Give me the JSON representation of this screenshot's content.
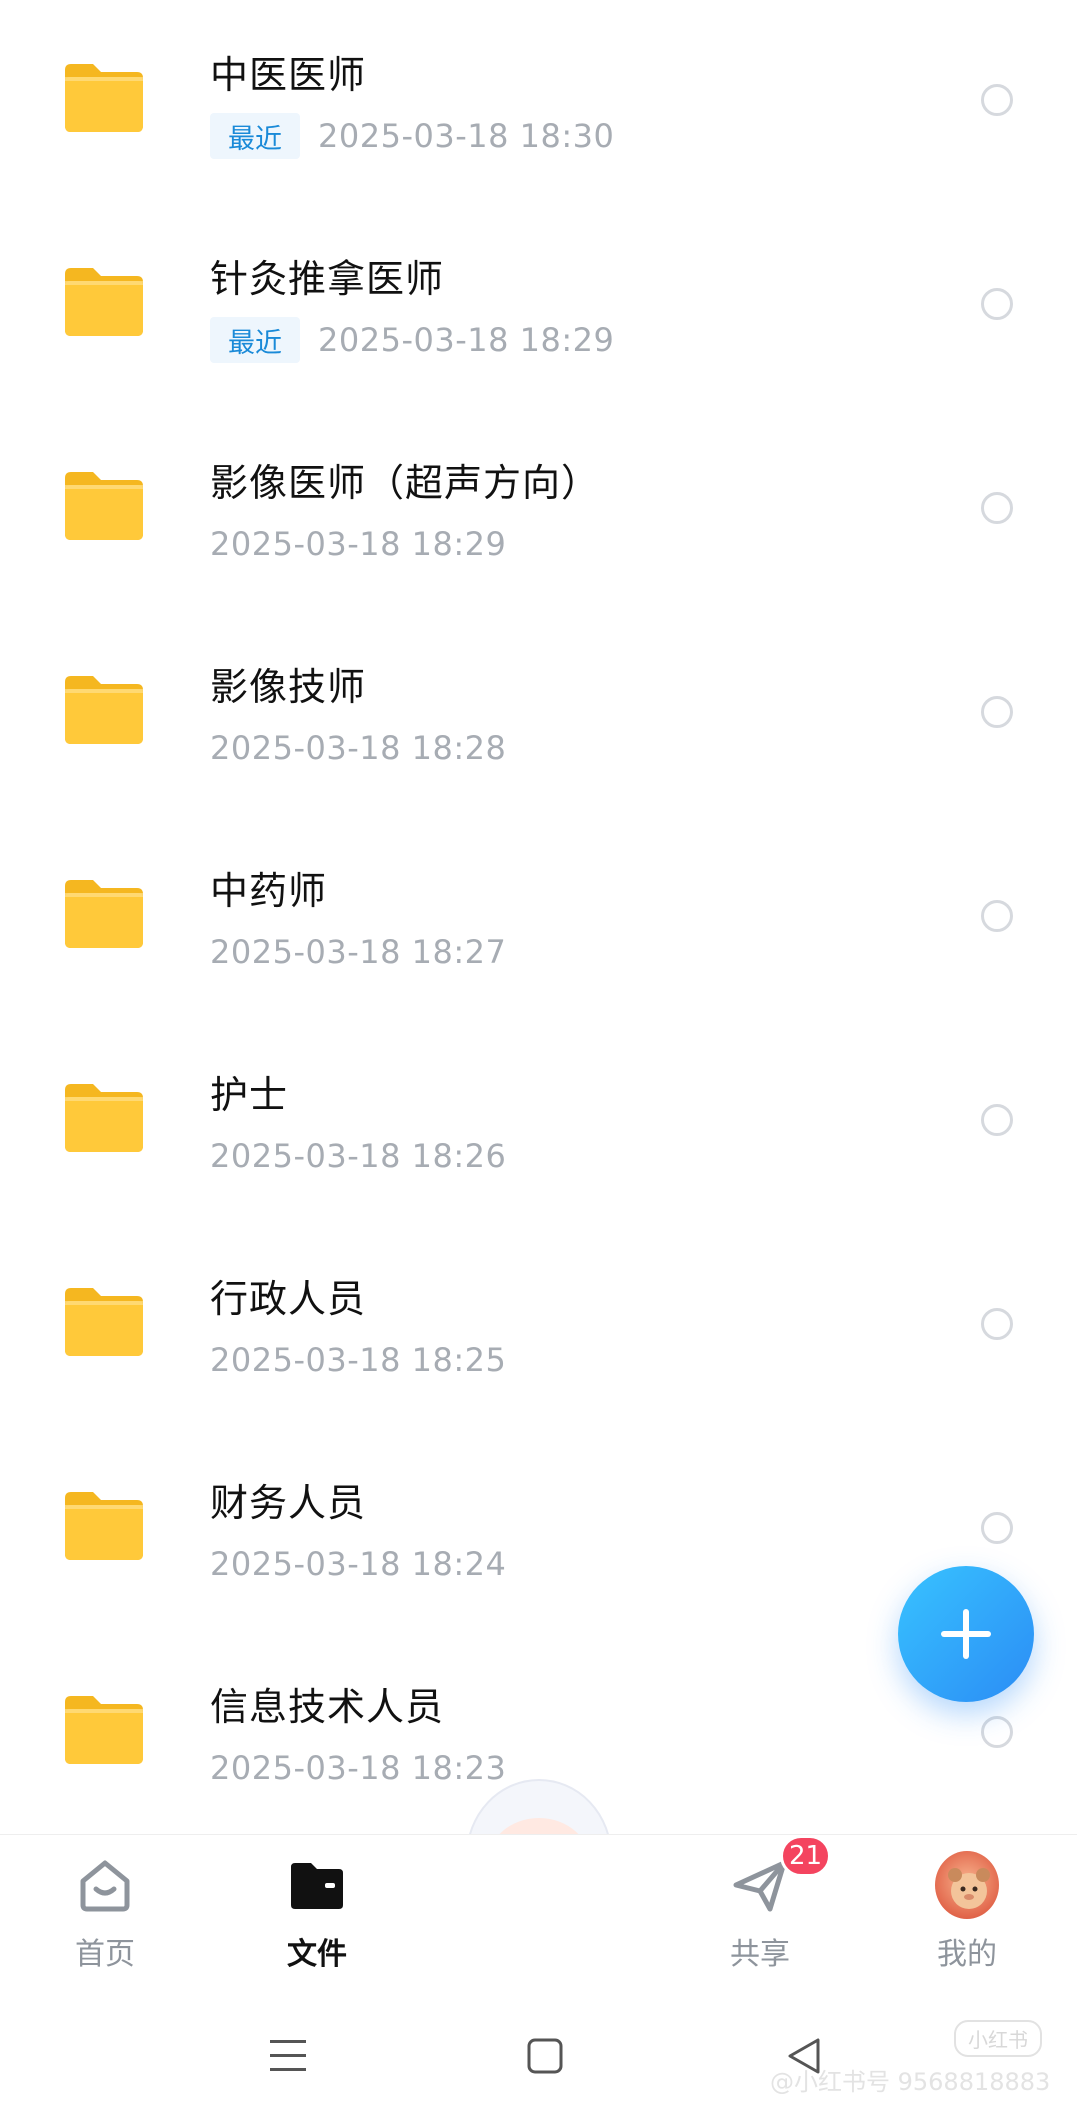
{
  "files": [
    {
      "name": "中医医师",
      "recent": true,
      "date": "2025-03-18  18:30"
    },
    {
      "name": "针灸推拿医师",
      "recent": true,
      "date": "2025-03-18  18:29"
    },
    {
      "name": "影像医师（超声方向）",
      "recent": false,
      "date": "2025-03-18  18:29"
    },
    {
      "name": "影像技师",
      "recent": false,
      "date": "2025-03-18  18:28"
    },
    {
      "name": "中药师",
      "recent": false,
      "date": "2025-03-18  18:27"
    },
    {
      "name": "护士",
      "recent": false,
      "date": "2025-03-18  18:26"
    },
    {
      "name": "行政人员",
      "recent": false,
      "date": "2025-03-18  18:25"
    },
    {
      "name": "财务人员",
      "recent": false,
      "date": "2025-03-18  18:24"
    },
    {
      "name": "信息技术人员",
      "recent": false,
      "date": "2025-03-18  18:23"
    }
  ],
  "recent_label": "最近",
  "tabs": {
    "home": {
      "label": "首页",
      "icon": "home-smile-icon"
    },
    "files": {
      "label": "文件",
      "icon": "folder-icon"
    },
    "share": {
      "label": "共享",
      "icon": "paper-plane-icon",
      "badge": "21"
    },
    "mine": {
      "label": "我的",
      "icon": "avatar"
    }
  },
  "active_tab": "files",
  "fab": {
    "icon": "plus-icon"
  },
  "watermark": {
    "tag": "小红书",
    "text": "@小红书号 9568818883"
  },
  "colors": {
    "accent": "#2b8cf5",
    "folder": "#ffc93a",
    "badge": "#f4445f",
    "recent_badge_text": "#1a8ad8",
    "date_text": "#a7acb3"
  }
}
